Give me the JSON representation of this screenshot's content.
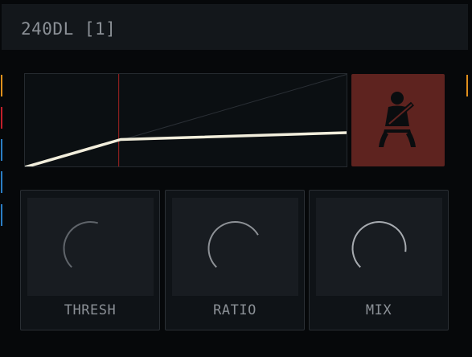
{
  "header": {
    "title": "240DL [1]"
  },
  "colors": {
    "accent_orange": "#e0901c",
    "accent_red": "#c21f2a",
    "accent_blue": "#2a7dc4",
    "curve": "#f2eedc",
    "threshold_line": "#8b1f1f",
    "button_bg": "#5e231f"
  },
  "graph": {
    "threshold_fraction": 0.29
  },
  "belt_button": {
    "icon": "seatbelt-icon"
  },
  "knobs": [
    {
      "label": "THRESH",
      "value": 0.56
    },
    {
      "label": "RATIO",
      "value": 0.72
    },
    {
      "label": "MIX",
      "value": 0.86
    }
  ]
}
